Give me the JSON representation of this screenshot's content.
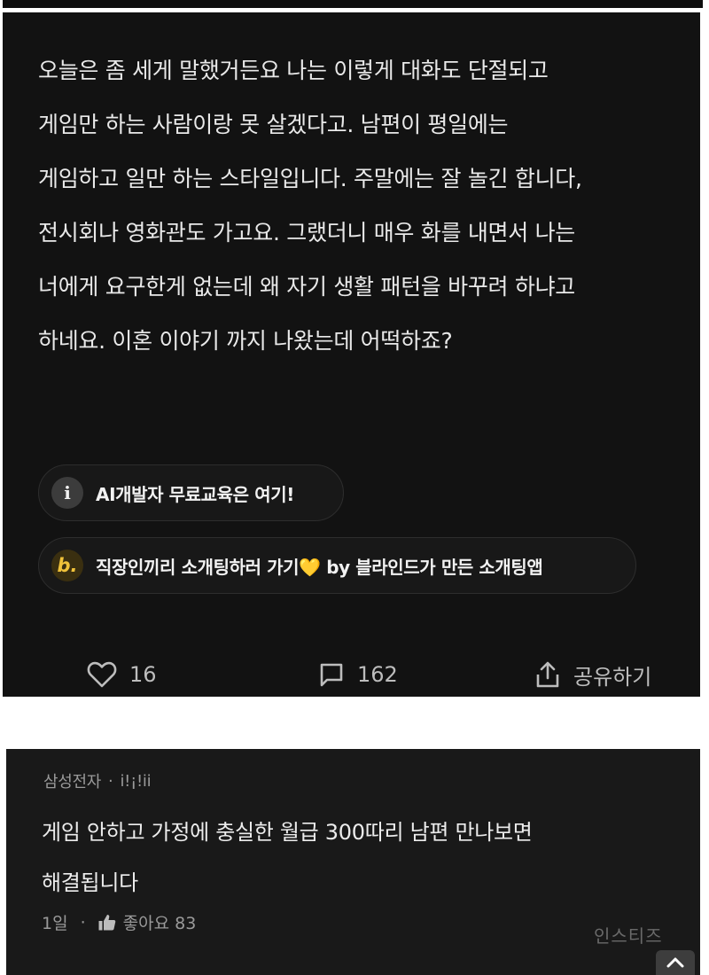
{
  "post": {
    "body_lines": [
      "오늘은 좀 세게 말했거든요 나는 이렇게 대화도 단절되고",
      "게임만 하는 사람이랑 못 살겠다고. 남편이 평일에는",
      "게임하고 일만 하는 스타일입니다. 주말에는 잘 놀긴 합니다,",
      "전시회나 영화관도 가고요. 그랬더니 매우 화를 내면서 나는",
      "너에게 요구한게 없는데 왜 자기 생활 패턴을 바꾸려 하냐고",
      "하네요. 이혼 이야기 까지 나왔는데 어떡하죠?"
    ],
    "promos": {
      "info": {
        "icon_text": "i",
        "label": "AI개발자 무료교육은 여기!"
      },
      "blind": {
        "icon_text": "b.",
        "label": "직장인끼리 소개팅하러 가기💛 by 블라인드가 만든 소개팅앱"
      }
    },
    "actions": {
      "like_count": "16",
      "comment_count": "162",
      "share_label": "공유하기"
    }
  },
  "comment": {
    "company": "삼성전자",
    "separator": "·",
    "nickname": "i!¡!ii",
    "text_lines": [
      "게임 안하고 가정에 충실한 월급 300따리 남편 만나보면",
      "해결됩니다"
    ],
    "time": "1일",
    "like_label": "좋아요 83"
  },
  "watermark": "인스티즈",
  "colors": {
    "post_bg": "#121212",
    "comment_bg": "#191919",
    "text_primary": "#e9e9e9",
    "text_muted": "#9a9a9a",
    "blind_accent": "#f0c23a"
  }
}
